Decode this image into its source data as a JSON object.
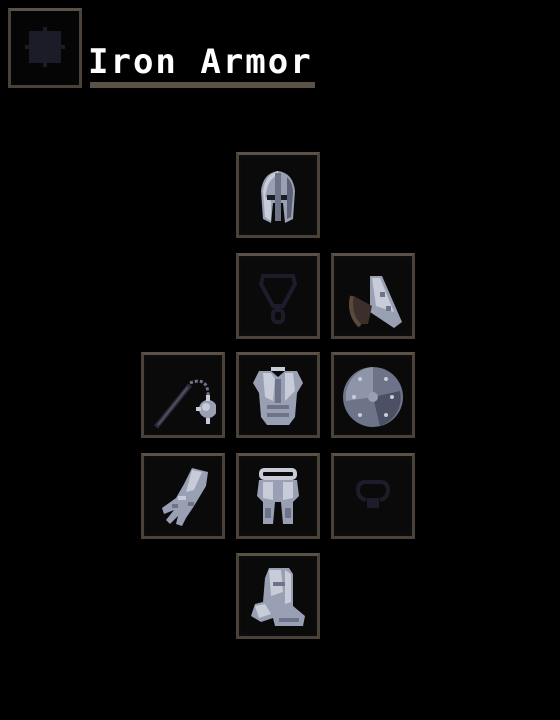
{
  "set": {
    "title": "Iron Armor"
  },
  "icons": {
    "menu": "grid-cross-icon",
    "head": "helmet-icon",
    "neck": "necklace-icon",
    "back": "pauldron-icon",
    "weapon": "flail-icon",
    "body": "breastplate-icon",
    "offhand": "round-shield-icon",
    "hands": "gauntlet-icon",
    "legs": "greaves-icon",
    "ring": "ring-icon",
    "feet": "boots-icon"
  },
  "colors": {
    "slot_border": "#4a4238",
    "metal_light": "#c8ccd8",
    "metal_mid": "#8f95a8",
    "metal_dark": "#4b5064",
    "empty_slot_glyph": "#1e1c2a"
  }
}
